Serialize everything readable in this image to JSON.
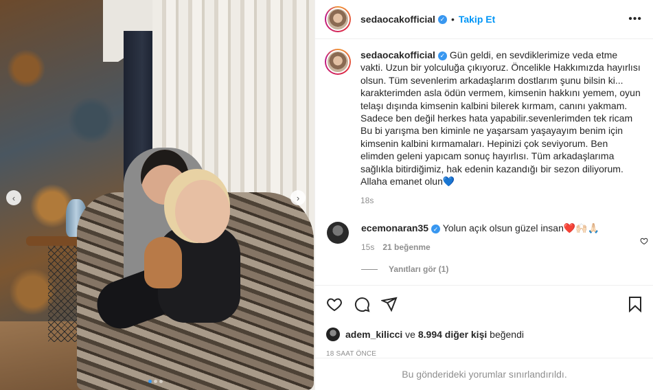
{
  "post": {
    "username": "sedaocakofficial",
    "follow_label": "Takip Et",
    "separator": "•",
    "more_label": "•••",
    "caption": "Gün geldi, en sevdiklerimize veda etme vakti. Uzun bir yolculuğa çıkıyoruz. Öncelikle Hakkımızda hayırlısı olsun. Tüm sevenlerim arkadaşlarım dostlarım şunu bilsin ki... karakterimden asla ödün vermem, kimsenin hakkını yemem, oyun telaşı dışında kimsenin kalbini bilerek kırmam, canını yakmam. Sadece ben değil herkes hata yapabilir.sevenlerimden tek ricam Bu bi yarışma ben kiminle ne yaşarsam yaşayayım benim için kimsenin kalbini kırmamaları. Hepinizi çok seviyorum. Ben elimden geleni yapıcam sonuç hayırlısı. Tüm arkadaşlarıma sağlıkla bitirdiğimiz, hak edenin kazandığı bir sezon diliyorum. Allaha emanet olun💙",
    "caption_time": "18s",
    "image_carousel": {
      "count": 3,
      "active_index": 0
    }
  },
  "comments": [
    {
      "username": "ecemonaran35",
      "text": "Yolun açık olsun güzel insan❤️🙌🏻🙏🏻",
      "time": "15s",
      "likes": "21 beğenme",
      "replies_label": "Yanıtları gör (1)"
    }
  ],
  "likes": {
    "user": "adem_kilicci",
    "connector": "ve",
    "others": "8.994 diğer kişi",
    "suffix": "beğendi"
  },
  "posted_ago": "18 SAAT ÖNCE",
  "footer_notice": "Bu gönderideki yorumlar sınırlandırıldı.",
  "icons": {
    "prev": "chevron-left-icon",
    "next": "chevron-right-icon",
    "like": "heart-icon",
    "comment": "comment-icon",
    "share": "paper-plane-icon",
    "save": "bookmark-icon",
    "verified": "verified-badge-icon"
  },
  "colors": {
    "accent": "#0095f6",
    "verified": "#3897f0",
    "muted": "#8e8e8e",
    "text": "#262626"
  }
}
